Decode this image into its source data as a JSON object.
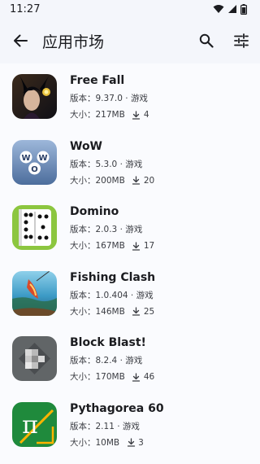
{
  "status": {
    "time": "11:27"
  },
  "header": {
    "title": "应用市场"
  },
  "labels": {
    "version_prefix": "版本：",
    "size_prefix": "大小：",
    "separator": "·"
  },
  "apps": [
    {
      "name": "Free Fall",
      "version": "9.37.0",
      "category": "游戏",
      "size": "217MB",
      "downloads": "4",
      "icon": "free-fall-icon"
    },
    {
      "name": "WoW",
      "version": "5.3.0",
      "category": "游戏",
      "size": "200MB",
      "downloads": "20",
      "icon": "wow-icon"
    },
    {
      "name": "Domino",
      "version": "2.0.3",
      "category": "游戏",
      "size": "167MB",
      "downloads": "17",
      "icon": "domino-icon"
    },
    {
      "name": "Fishing Clash",
      "version": "1.0.404",
      "category": "游戏",
      "size": "146MB",
      "downloads": "25",
      "icon": "fishing-clash-icon"
    },
    {
      "name": "Block Blast!",
      "version": "8.2.4",
      "category": "游戏",
      "size": "170MB",
      "downloads": "46",
      "icon": "block-blast-icon"
    },
    {
      "name": "Pythagorea 60",
      "version": "2.11",
      "category": "游戏",
      "size": "10MB",
      "downloads": "3",
      "icon": "pythagorea-icon"
    }
  ]
}
